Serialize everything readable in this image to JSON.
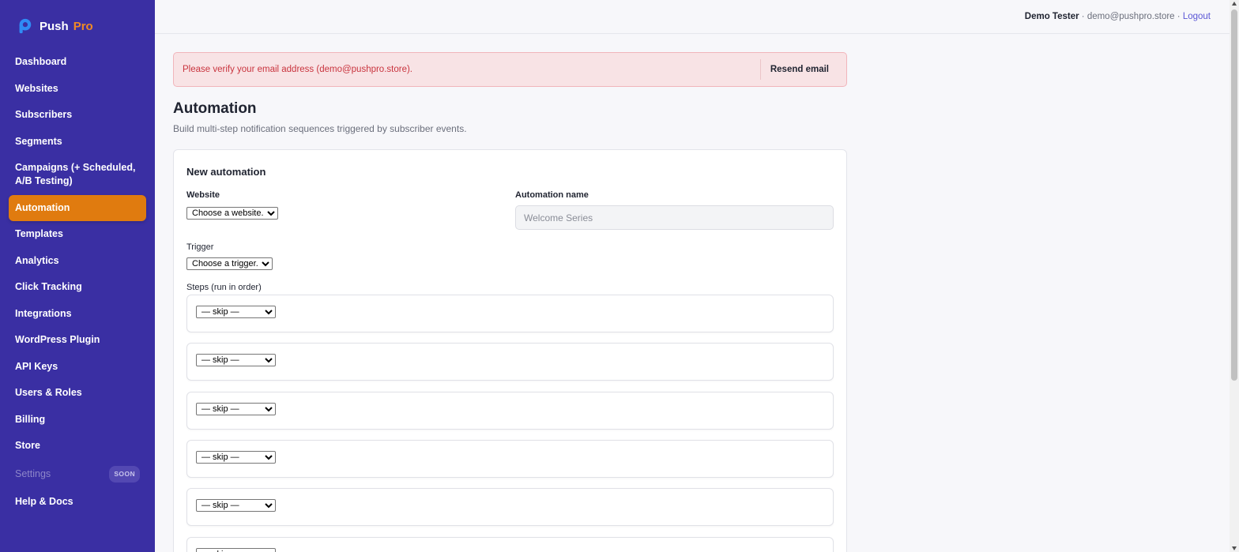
{
  "brand": {
    "name_primary": "Push",
    "name_secondary": "Pro"
  },
  "sidebar": {
    "items": [
      {
        "label": "Dashboard"
      },
      {
        "label": "Websites"
      },
      {
        "label": "Subscribers"
      },
      {
        "label": "Segments"
      },
      {
        "label": "Campaigns (+ Scheduled, A/B Testing)"
      },
      {
        "label": "Automation",
        "active": true
      },
      {
        "label": "Templates"
      },
      {
        "label": "Analytics"
      },
      {
        "label": "Click Tracking"
      },
      {
        "label": "Integrations"
      },
      {
        "label": "WordPress Plugin"
      },
      {
        "label": "API Keys"
      },
      {
        "label": "Users & Roles"
      },
      {
        "label": "Billing"
      },
      {
        "label": "Store"
      },
      {
        "label": "Settings",
        "badge": "SOON",
        "disabled": true
      },
      {
        "label": "Help & Docs"
      }
    ]
  },
  "topbar": {
    "user_name": "Demo Tester",
    "sep1": " · ",
    "user_email": "demo@pushpro.store",
    "sep2": " · ",
    "logout_label": "Logout"
  },
  "alert": {
    "message": "Please verify your email address (demo@pushpro.store).",
    "button_label": "Resend email"
  },
  "page": {
    "title": "Automation",
    "subtitle": "Build multi-step notification sequences triggered by subscriber events."
  },
  "form": {
    "card_title": "New automation",
    "website_label": "Website",
    "website_selected": "Choose a website...",
    "name_label": "Automation name",
    "name_placeholder": "Welcome Series",
    "trigger_label": "Trigger",
    "trigger_selected": "Choose a trigger...",
    "steps_label": "Steps (run in order)",
    "steps": [
      {
        "selected": "— skip —"
      },
      {
        "selected": "— skip —"
      },
      {
        "selected": "— skip —"
      },
      {
        "selected": "— skip —"
      },
      {
        "selected": "— skip —"
      },
      {
        "selected": "— skip —"
      }
    ]
  },
  "colors": {
    "sidebar_bg": "#3a2fa3",
    "accent": "#e07b0f",
    "brand_secondary": "#f08a24",
    "alert_bg": "#f8e3e5",
    "alert_text": "#c9343e",
    "link": "#5b57d6"
  },
  "icons": {
    "brand_logo": "pushpro-logo-icon"
  }
}
